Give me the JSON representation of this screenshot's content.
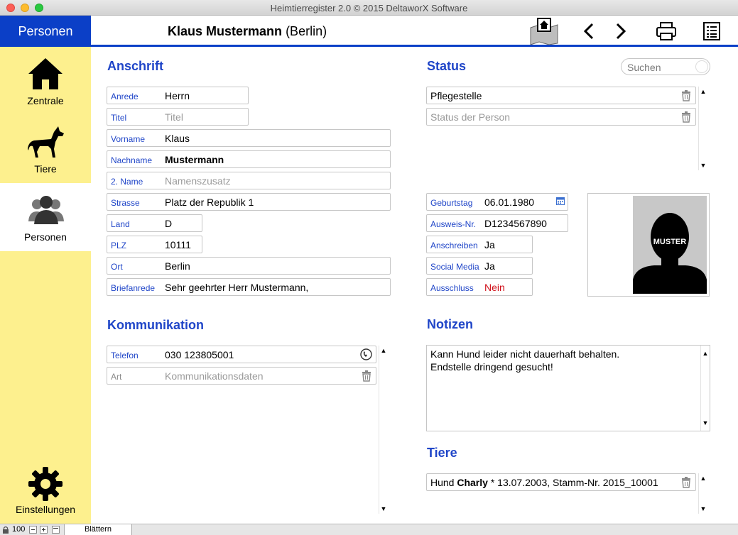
{
  "window": {
    "title": "Heimtierregister 2.0 © 2015 DeltaworX Software"
  },
  "sidebar": {
    "header": "Personen",
    "items": [
      {
        "label": "Zentrale",
        "icon": "house-icon"
      },
      {
        "label": "Tiere",
        "icon": "dog-icon"
      },
      {
        "label": "Personen",
        "icon": "people-icon",
        "active": true
      },
      {
        "label": "Einstellungen",
        "icon": "gear-icon"
      }
    ]
  },
  "header": {
    "name": "Klaus Mustermann",
    "city": "(Berlin)"
  },
  "sections": {
    "anschrift": "Anschrift",
    "status": "Status",
    "kommunikation": "Kommunikation",
    "notizen": "Notizen",
    "tiere": "Tiere"
  },
  "search": {
    "placeholder": "Suchen"
  },
  "address": {
    "anrede": {
      "label": "Anrede",
      "value": "Herrn"
    },
    "titel": {
      "label": "Titel",
      "value": "Titel"
    },
    "vorname": {
      "label": "Vorname",
      "value": "Klaus"
    },
    "nachname": {
      "label": "Nachname",
      "value": "Mustermann"
    },
    "zweitname": {
      "label": "2. Name",
      "value": "Namenszusatz"
    },
    "strasse": {
      "label": "Strasse",
      "value": "Platz der Republik 1"
    },
    "land": {
      "label": "Land",
      "value": "D"
    },
    "plz": {
      "label": "PLZ",
      "value": "10111"
    },
    "ort": {
      "label": "Ort",
      "value": "Berlin"
    },
    "briefanrede": {
      "label": "Briefanrede",
      "value": "Sehr geehrter Herr Mustermann,"
    }
  },
  "status": {
    "items": [
      "Pflegestelle",
      "Status der Person"
    ]
  },
  "details": {
    "geburtstag": {
      "label": "Geburtstag",
      "value": "06.01.1980"
    },
    "ausweis": {
      "label": "Ausweis-Nr.",
      "value": "D1234567890"
    },
    "anschreiben": {
      "label": "Anschreiben",
      "value": "Ja"
    },
    "social": {
      "label": "Social Media",
      "value": "Ja"
    },
    "ausschluss": {
      "label": "Ausschluss",
      "value": "Nein"
    }
  },
  "photo": {
    "overlay_text": "MUSTER"
  },
  "kommunikation": {
    "telefon": {
      "label": "Telefon",
      "value": "030 123805001"
    },
    "art": {
      "label": "Art",
      "value": "Kommunikationsdaten"
    }
  },
  "notizen": {
    "text": "Kann Hund leider nicht dauerhaft behalten.\nEndstelle dringend gesucht!"
  },
  "tiere": {
    "entry_prefix": "Hund ",
    "entry_name": "Charly",
    "entry_suffix": " * 13.07.2003, Stamm-Nr. 2015_10001"
  },
  "statusbar": {
    "zoom": "100",
    "mode": "Blättern"
  },
  "colors": {
    "accent": "#0b3fc7",
    "sidebar": "#fdf08e",
    "label_blue": "#1f45c8",
    "alert_red": "#d0101a"
  }
}
